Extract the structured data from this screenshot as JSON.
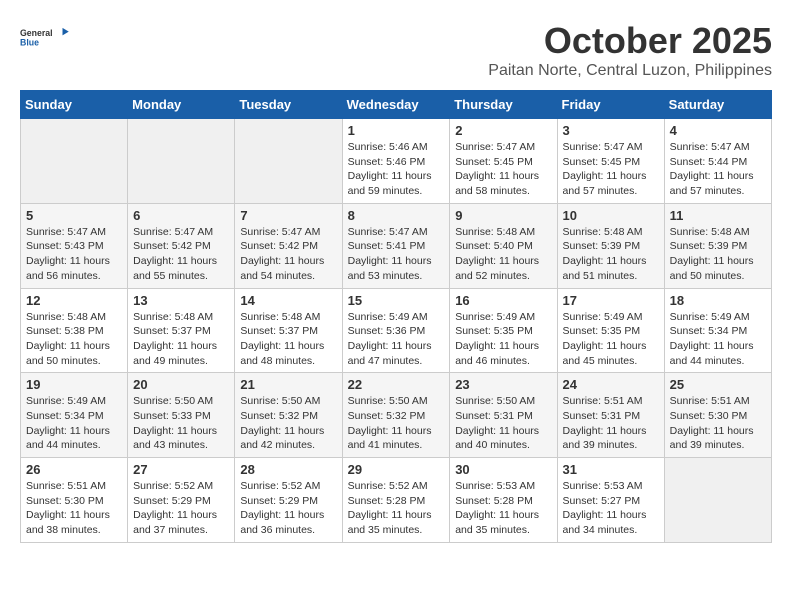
{
  "header": {
    "logo_general": "General",
    "logo_blue": "Blue",
    "month": "October 2025",
    "location": "Paitan Norte, Central Luzon, Philippines"
  },
  "weekdays": [
    "Sunday",
    "Monday",
    "Tuesday",
    "Wednesday",
    "Thursday",
    "Friday",
    "Saturday"
  ],
  "weeks": [
    [
      {
        "day": "",
        "sunrise": "",
        "sunset": "",
        "daylight": ""
      },
      {
        "day": "",
        "sunrise": "",
        "sunset": "",
        "daylight": ""
      },
      {
        "day": "",
        "sunrise": "",
        "sunset": "",
        "daylight": ""
      },
      {
        "day": "1",
        "sunrise": "Sunrise: 5:46 AM",
        "sunset": "Sunset: 5:46 PM",
        "daylight": "Daylight: 11 hours and 59 minutes."
      },
      {
        "day": "2",
        "sunrise": "Sunrise: 5:47 AM",
        "sunset": "Sunset: 5:45 PM",
        "daylight": "Daylight: 11 hours and 58 minutes."
      },
      {
        "day": "3",
        "sunrise": "Sunrise: 5:47 AM",
        "sunset": "Sunset: 5:45 PM",
        "daylight": "Daylight: 11 hours and 57 minutes."
      },
      {
        "day": "4",
        "sunrise": "Sunrise: 5:47 AM",
        "sunset": "Sunset: 5:44 PM",
        "daylight": "Daylight: 11 hours and 57 minutes."
      }
    ],
    [
      {
        "day": "5",
        "sunrise": "Sunrise: 5:47 AM",
        "sunset": "Sunset: 5:43 PM",
        "daylight": "Daylight: 11 hours and 56 minutes."
      },
      {
        "day": "6",
        "sunrise": "Sunrise: 5:47 AM",
        "sunset": "Sunset: 5:42 PM",
        "daylight": "Daylight: 11 hours and 55 minutes."
      },
      {
        "day": "7",
        "sunrise": "Sunrise: 5:47 AM",
        "sunset": "Sunset: 5:42 PM",
        "daylight": "Daylight: 11 hours and 54 minutes."
      },
      {
        "day": "8",
        "sunrise": "Sunrise: 5:47 AM",
        "sunset": "Sunset: 5:41 PM",
        "daylight": "Daylight: 11 hours and 53 minutes."
      },
      {
        "day": "9",
        "sunrise": "Sunrise: 5:48 AM",
        "sunset": "Sunset: 5:40 PM",
        "daylight": "Daylight: 11 hours and 52 minutes."
      },
      {
        "day": "10",
        "sunrise": "Sunrise: 5:48 AM",
        "sunset": "Sunset: 5:39 PM",
        "daylight": "Daylight: 11 hours and 51 minutes."
      },
      {
        "day": "11",
        "sunrise": "Sunrise: 5:48 AM",
        "sunset": "Sunset: 5:39 PM",
        "daylight": "Daylight: 11 hours and 50 minutes."
      }
    ],
    [
      {
        "day": "12",
        "sunrise": "Sunrise: 5:48 AM",
        "sunset": "Sunset: 5:38 PM",
        "daylight": "Daylight: 11 hours and 50 minutes."
      },
      {
        "day": "13",
        "sunrise": "Sunrise: 5:48 AM",
        "sunset": "Sunset: 5:37 PM",
        "daylight": "Daylight: 11 hours and 49 minutes."
      },
      {
        "day": "14",
        "sunrise": "Sunrise: 5:48 AM",
        "sunset": "Sunset: 5:37 PM",
        "daylight": "Daylight: 11 hours and 48 minutes."
      },
      {
        "day": "15",
        "sunrise": "Sunrise: 5:49 AM",
        "sunset": "Sunset: 5:36 PM",
        "daylight": "Daylight: 11 hours and 47 minutes."
      },
      {
        "day": "16",
        "sunrise": "Sunrise: 5:49 AM",
        "sunset": "Sunset: 5:35 PM",
        "daylight": "Daylight: 11 hours and 46 minutes."
      },
      {
        "day": "17",
        "sunrise": "Sunrise: 5:49 AM",
        "sunset": "Sunset: 5:35 PM",
        "daylight": "Daylight: 11 hours and 45 minutes."
      },
      {
        "day": "18",
        "sunrise": "Sunrise: 5:49 AM",
        "sunset": "Sunset: 5:34 PM",
        "daylight": "Daylight: 11 hours and 44 minutes."
      }
    ],
    [
      {
        "day": "19",
        "sunrise": "Sunrise: 5:49 AM",
        "sunset": "Sunset: 5:34 PM",
        "daylight": "Daylight: 11 hours and 44 minutes."
      },
      {
        "day": "20",
        "sunrise": "Sunrise: 5:50 AM",
        "sunset": "Sunset: 5:33 PM",
        "daylight": "Daylight: 11 hours and 43 minutes."
      },
      {
        "day": "21",
        "sunrise": "Sunrise: 5:50 AM",
        "sunset": "Sunset: 5:32 PM",
        "daylight": "Daylight: 11 hours and 42 minutes."
      },
      {
        "day": "22",
        "sunrise": "Sunrise: 5:50 AM",
        "sunset": "Sunset: 5:32 PM",
        "daylight": "Daylight: 11 hours and 41 minutes."
      },
      {
        "day": "23",
        "sunrise": "Sunrise: 5:50 AM",
        "sunset": "Sunset: 5:31 PM",
        "daylight": "Daylight: 11 hours and 40 minutes."
      },
      {
        "day": "24",
        "sunrise": "Sunrise: 5:51 AM",
        "sunset": "Sunset: 5:31 PM",
        "daylight": "Daylight: 11 hours and 39 minutes."
      },
      {
        "day": "25",
        "sunrise": "Sunrise: 5:51 AM",
        "sunset": "Sunset: 5:30 PM",
        "daylight": "Daylight: 11 hours and 39 minutes."
      }
    ],
    [
      {
        "day": "26",
        "sunrise": "Sunrise: 5:51 AM",
        "sunset": "Sunset: 5:30 PM",
        "daylight": "Daylight: 11 hours and 38 minutes."
      },
      {
        "day": "27",
        "sunrise": "Sunrise: 5:52 AM",
        "sunset": "Sunset: 5:29 PM",
        "daylight": "Daylight: 11 hours and 37 minutes."
      },
      {
        "day": "28",
        "sunrise": "Sunrise: 5:52 AM",
        "sunset": "Sunset: 5:29 PM",
        "daylight": "Daylight: 11 hours and 36 minutes."
      },
      {
        "day": "29",
        "sunrise": "Sunrise: 5:52 AM",
        "sunset": "Sunset: 5:28 PM",
        "daylight": "Daylight: 11 hours and 35 minutes."
      },
      {
        "day": "30",
        "sunrise": "Sunrise: 5:53 AM",
        "sunset": "Sunset: 5:28 PM",
        "daylight": "Daylight: 11 hours and 35 minutes."
      },
      {
        "day": "31",
        "sunrise": "Sunrise: 5:53 AM",
        "sunset": "Sunset: 5:27 PM",
        "daylight": "Daylight: 11 hours and 34 minutes."
      },
      {
        "day": "",
        "sunrise": "",
        "sunset": "",
        "daylight": ""
      }
    ]
  ]
}
